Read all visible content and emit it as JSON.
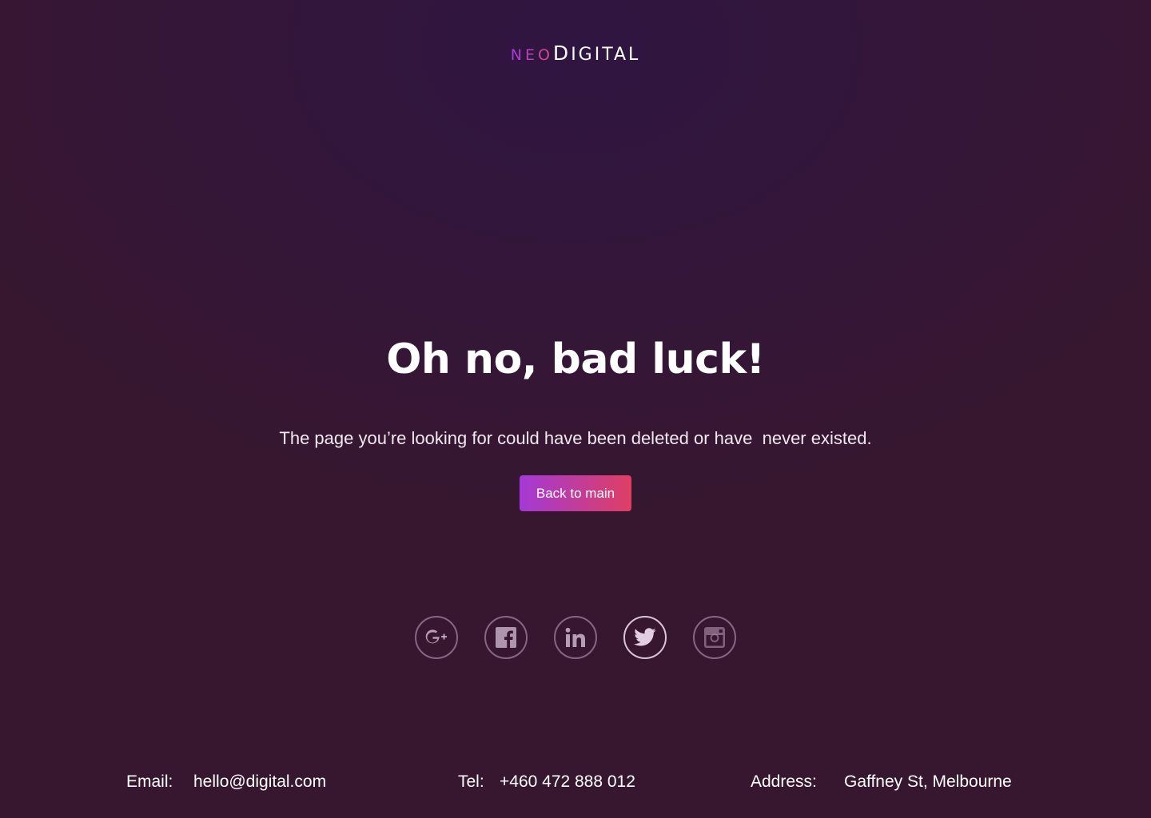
{
  "logo": {
    "neo": "NEO",
    "digital": "DIGITAL",
    "accent_gradient": [
      "#a43be0",
      "#e04a7a"
    ]
  },
  "hero": {
    "title": "Oh no, bad luck!",
    "message": "The page you’re looking for could have been deleted or have  never existed.",
    "button_label": "Back to main"
  },
  "social": [
    {
      "name": "google-plus",
      "icon": "google-plus-icon"
    },
    {
      "name": "facebook",
      "icon": "facebook-icon"
    },
    {
      "name": "linkedin",
      "icon": "linkedin-icon"
    },
    {
      "name": "twitter",
      "icon": "twitter-icon",
      "highlighted": true
    },
    {
      "name": "instagram",
      "icon": "instagram-icon"
    }
  ],
  "footer": {
    "email_label": "Email:",
    "email_value": "hello@digital.com",
    "tel_label": "Tel:",
    "tel_value": "+460 472 888 012",
    "address_label": "Address:",
    "address_value": "Gaffney St, Melbourne"
  },
  "colors": {
    "background": "#37172f",
    "button_gradient": [
      "#a339d6",
      "#df3f62"
    ]
  }
}
